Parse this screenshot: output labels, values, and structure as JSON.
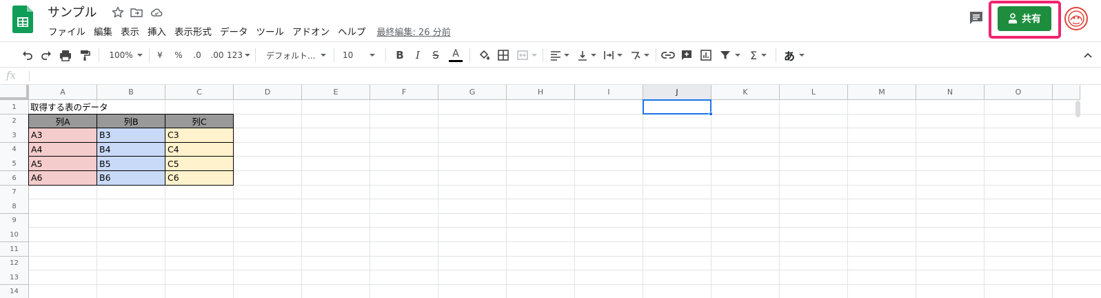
{
  "doc": {
    "title": "サンプル",
    "last_edit": "最終編集: 26 分前"
  },
  "menus": [
    "ファイル",
    "編集",
    "表示",
    "挿入",
    "表示形式",
    "データ",
    "ツール",
    "アドオン",
    "ヘルプ"
  ],
  "share_label": "共有",
  "toolbar": {
    "zoom": "100%",
    "currency": "¥",
    "percent": "%",
    "decrease_decimal": ".0",
    "increase_decimal": ".00",
    "number_format": "123",
    "font": "デフォルト...",
    "font_size": "10",
    "bold": "B",
    "italic": "I",
    "strike": "S",
    "text_color": "A",
    "sum": "Σ",
    "input_tool": "あ"
  },
  "formula_bar": {
    "fx": "fx",
    "value": ""
  },
  "columns": [
    "A",
    "B",
    "C",
    "D",
    "E",
    "F",
    "G",
    "H",
    "I",
    "J",
    "K",
    "L",
    "M",
    "N",
    "O"
  ],
  "rows": [
    "1",
    "2",
    "3",
    "4",
    "5",
    "6",
    "7",
    "8",
    "9",
    "10",
    "11",
    "12",
    "13",
    "14"
  ],
  "selected": {
    "column": "J",
    "row": "1"
  },
  "cells": {
    "A1": "取得する表のデータ",
    "A2": "列A",
    "B2": "列B",
    "C2": "列C",
    "A3": "A3",
    "B3": "B3",
    "C3": "C3",
    "A4": "A4",
    "B4": "B4",
    "C4": "C4",
    "A5": "A5",
    "B5": "B5",
    "C5": "C5",
    "A6": "A6",
    "B6": "B6",
    "C6": "C6"
  },
  "colors": {
    "header_fill": "#999999",
    "col_a_fill": "#f4cccc",
    "col_b_fill": "#c9daf8",
    "col_c_fill": "#fff2cc",
    "share_green": "#1e8e3e",
    "highlight": "#f0256d",
    "selection": "#1a73e8"
  },
  "icons": {
    "logo": "google-sheets-logo",
    "star": "star-icon",
    "move": "move-to-folder-icon",
    "cloud": "cloud-status-icon",
    "comments": "comment-history-icon",
    "avatar": "user-avatar"
  }
}
